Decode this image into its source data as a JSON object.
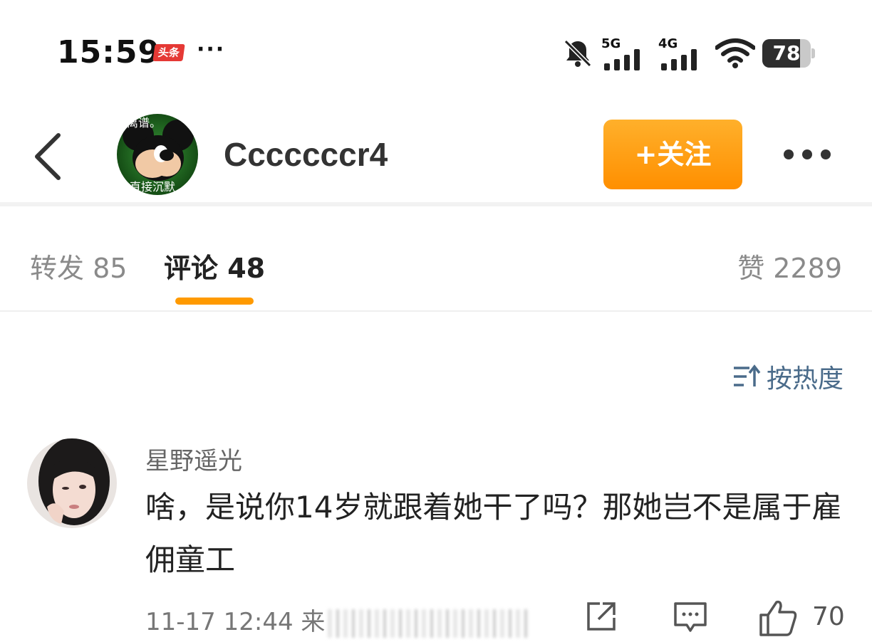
{
  "status_bar": {
    "time": "15:59",
    "app_badge": "头条",
    "more": "···",
    "signal_1_label": "5G",
    "signal_2_label": "4G",
    "battery": "78",
    "battery_level": 0.78
  },
  "header": {
    "username": "Cccccccr4",
    "follow_label": "+关注",
    "avatar_text_top": "离谱。",
    "avatar_text_bottom": "直接沉默"
  },
  "tabs": {
    "repost": "转发 85",
    "comment": "评论 48",
    "like": "赞 2289"
  },
  "sort": {
    "label": "按热度"
  },
  "comment": {
    "username": "星野遥光",
    "text": "啥，是说你14岁就跟着她干了吗？那她岂不是属于雇佣童工",
    "meta": "11-17 12:44 来",
    "like_count": "70"
  },
  "colors": {
    "accent_orange": "#ff9a00",
    "sort_blue": "#4a6b8a"
  }
}
